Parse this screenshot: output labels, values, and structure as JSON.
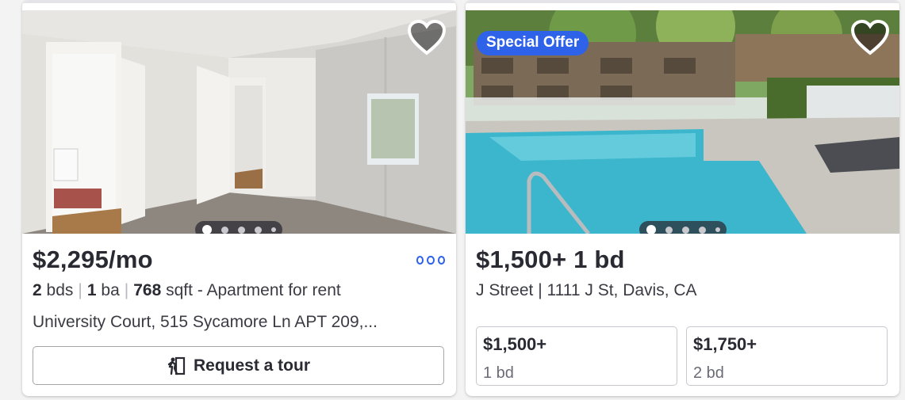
{
  "listings": [
    {
      "price": "$2,295/mo",
      "beds_num": "2",
      "beds_unit": "bds",
      "baths_num": "1",
      "baths_unit": "ba",
      "sqft_num": "768",
      "sqft_unit": "sqft",
      "type": "- Apartment for rent",
      "sep": "|",
      "address": "University Court, 515 Sycamore Ln APT 209,...",
      "tour_label": "Request a tour",
      "favorite_icon": "heart-outline-icon",
      "photo_index": 1,
      "photo_count": 5
    },
    {
      "badge": "Special Offer",
      "price": "$1,500+ 1 bd",
      "address": "J Street | 1111 J St, Davis, CA",
      "favorite_icon": "heart-outline-icon",
      "photo_index": 1,
      "photo_count": 5,
      "units": [
        {
          "price": "$1,500+",
          "beds": "1 bd"
        },
        {
          "price": "$1,750+",
          "beds": "2 bd"
        }
      ]
    }
  ],
  "colors": {
    "accent_blue": "#2e62e8",
    "text_primary": "#2a2a33",
    "text_muted": "#6b6b78"
  }
}
